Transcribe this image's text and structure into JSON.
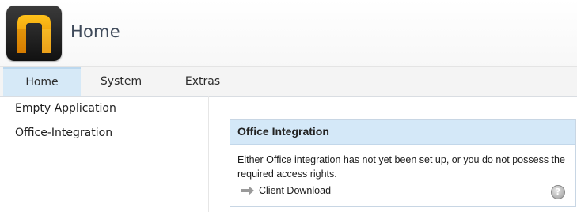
{
  "header": {
    "title": "Home",
    "logo": "app-logo"
  },
  "menu": {
    "tabs": [
      {
        "label": "Home",
        "active": true
      },
      {
        "label": "System",
        "active": false
      },
      {
        "label": "Extras",
        "active": false
      }
    ]
  },
  "sidebar": {
    "items": [
      {
        "label": "Empty Application"
      },
      {
        "label": "Office-Integration"
      }
    ]
  },
  "panel": {
    "title": "Office Integration",
    "message": "Either Office integration has not yet been set up, or you do not possess the required access rights.",
    "download_link": "Client Download",
    "download_icon": "arrow-right-icon",
    "help_icon": "help-icon",
    "help_glyph": "?"
  },
  "colors": {
    "active_tab": "#d6e9f7",
    "panel_header": "#d4e8f8",
    "logo_accent": "#f5a100"
  }
}
